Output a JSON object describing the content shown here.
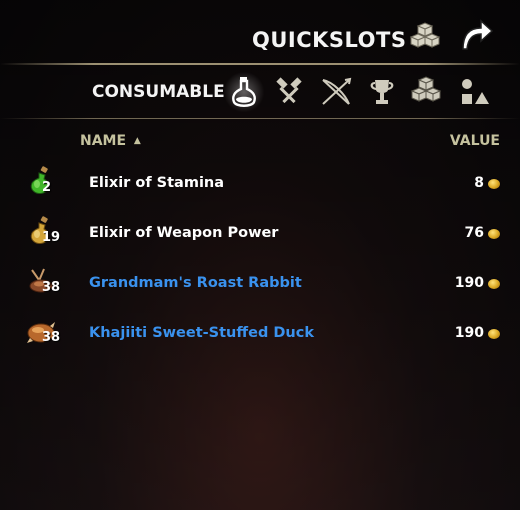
{
  "header": {
    "title": "QUICKSLOTS",
    "icons": [
      "quickslot-cubes-icon",
      "return-arrow-icon"
    ]
  },
  "filter": {
    "category_label": "CONSUMABLE",
    "tabs": [
      {
        "name": "potion-tab",
        "icon": "potion-flask-icon",
        "active": true
      },
      {
        "name": "crafting-tab",
        "icon": "crossed-hammers-icon",
        "active": false
      },
      {
        "name": "siege-tab",
        "icon": "crossbow-siege-icon",
        "active": false
      },
      {
        "name": "trophy-tab",
        "icon": "trophy-cup-icon",
        "active": false
      },
      {
        "name": "collectibles-tab",
        "icon": "cubes-icon",
        "active": false
      },
      {
        "name": "misc-tab",
        "icon": "shapes-icon",
        "active": false
      }
    ]
  },
  "columns": {
    "name": "NAME",
    "sort_indicator": "▲",
    "value": "VALUE"
  },
  "items": [
    {
      "name": "Elixir of Stamina",
      "qty": "2",
      "value": "8",
      "color": "#ffffff",
      "icon": "green-potion-icon"
    },
    {
      "name": "Elixir of Weapon Power",
      "qty": "19",
      "value": "76",
      "color": "#ffffff",
      "icon": "yellow-potion-icon"
    },
    {
      "name": "Grandmam's Roast Rabbit",
      "qty": "38",
      "value": "190",
      "color": "#3a92ee",
      "icon": "roast-rabbit-icon"
    },
    {
      "name": "Khajiiti Sweet-Stuffed Duck",
      "qty": "38",
      "value": "190",
      "color": "#3a92ee",
      "icon": "roast-duck-icon"
    }
  ],
  "colors": {
    "magic_item": "#3a92ee",
    "normal_item": "#ffffff",
    "header_gold": "#c5c29e",
    "gold_coin": "#d9a520"
  }
}
